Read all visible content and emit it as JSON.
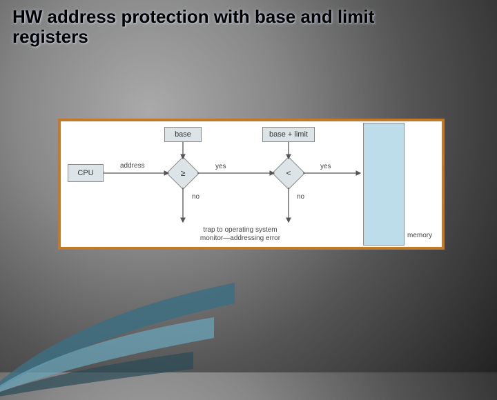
{
  "title": "HW address protection with base and limit registers",
  "diagram": {
    "cpu": "CPU",
    "base": "base",
    "base_limit": "base + limit",
    "cmp1": "≥",
    "cmp2": "<",
    "address": "address",
    "yes": "yes",
    "no": "no",
    "trap_line1": "trap to operating system",
    "trap_line2": "monitor—addressing error",
    "memory": "memory"
  },
  "chart_data": {
    "type": "diagram",
    "title": "HW address protection with base and limit registers",
    "nodes": [
      {
        "id": "cpu",
        "label": "CPU",
        "kind": "box"
      },
      {
        "id": "base",
        "label": "base",
        "kind": "box"
      },
      {
        "id": "base_limit",
        "label": "base + limit",
        "kind": "box"
      },
      {
        "id": "cmp1",
        "label": "≥",
        "kind": "decision"
      },
      {
        "id": "cmp2",
        "label": "<",
        "kind": "decision"
      },
      {
        "id": "memory",
        "label": "memory",
        "kind": "box"
      },
      {
        "id": "trap",
        "label": "trap to operating system monitor—addressing error",
        "kind": "text"
      }
    ],
    "edges": [
      {
        "from": "cpu",
        "to": "cmp1",
        "label": "address"
      },
      {
        "from": "base",
        "to": "cmp1"
      },
      {
        "from": "cmp1",
        "to": "cmp2",
        "label": "yes"
      },
      {
        "from": "cmp1",
        "to": "trap",
        "label": "no"
      },
      {
        "from": "base_limit",
        "to": "cmp2"
      },
      {
        "from": "cmp2",
        "to": "memory",
        "label": "yes"
      },
      {
        "from": "cmp2",
        "to": "trap",
        "label": "no"
      }
    ]
  }
}
